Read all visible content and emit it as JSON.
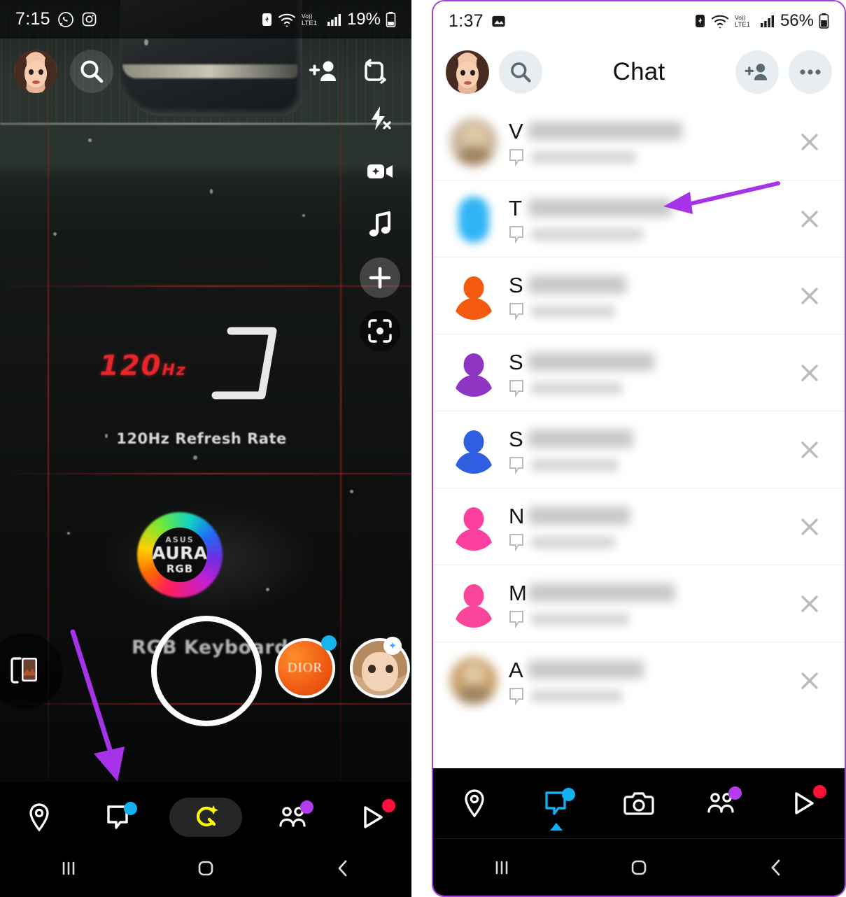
{
  "left_phone": {
    "status_bar": {
      "time": "7:15",
      "icons": [
        "whatsapp-icon",
        "instagram-icon"
      ],
      "right_icons": [
        "alarm-icon",
        "wifi-icon",
        "volte-lte1-icon",
        "signal-icon"
      ],
      "battery_percent": "19%"
    },
    "camera_top": {
      "avatar": "bitmoji-avatar",
      "search": "search-icon",
      "add_friend": "add-friend-icon",
      "flip_camera": "flip-camera-icon"
    },
    "camera_rail": [
      {
        "name": "flash-off-icon"
      },
      {
        "name": "night-video-icon"
      },
      {
        "name": "music-icon"
      },
      {
        "name": "add-lens-icon"
      },
      {
        "name": "scan-icon"
      }
    ],
    "scene": {
      "hz_main": "120",
      "hz_unit": "Hz",
      "caption": "120Hz Refresh Rate",
      "aura_brand": "ASUS",
      "aura_main": "AURA",
      "aura_sub": "RGB",
      "rgb_keyboard": "RGB Keyboard"
    },
    "capture_bar": {
      "memories": "memories-icon",
      "shutter": "shutter-button",
      "lens_1": "DIOR",
      "lens_2": "disney-lens"
    },
    "bottom_nav": [
      {
        "name": "map-tab",
        "icon": "location-pin-icon",
        "badge": "",
        "active": false
      },
      {
        "name": "chat-tab",
        "icon": "chat-bubble-icon",
        "badge": "blue",
        "active": false
      },
      {
        "name": "camera-tab",
        "icon": "sparkle-camera-icon",
        "badge": "",
        "active": true
      },
      {
        "name": "stories-tab",
        "icon": "friends-icon",
        "badge": "purple",
        "active": false
      },
      {
        "name": "spotlight-tab",
        "icon": "play-icon",
        "badge": "red",
        "active": false
      }
    ],
    "system_nav": [
      "recents-icon",
      "home-icon",
      "back-icon"
    ]
  },
  "right_phone": {
    "status_bar": {
      "time": "1:37",
      "icons": [
        "screenshot-icon"
      ],
      "right_icons": [
        "alarm-icon",
        "wifi-icon",
        "volte-lte1-icon",
        "signal-icon"
      ],
      "battery_percent": "56%"
    },
    "header": {
      "avatar": "bitmoji-avatar",
      "search": "search-icon",
      "title": "Chat",
      "add_friend": "add-friend-icon",
      "more": "more-options-icon"
    },
    "chat_rows": [
      {
        "initial": "V",
        "avatar_type": "photo",
        "avatar_color": "#c9b79c",
        "name_width": 220,
        "sub_width": 150,
        "close": "close-icon"
      },
      {
        "initial": "T",
        "avatar_type": "color",
        "avatar_color": "#2fb4f5",
        "name_width": 205,
        "sub_width": 160,
        "close": "close-icon"
      },
      {
        "initial": "S",
        "avatar_type": "color",
        "avatar_color": "#f35a10",
        "name_width": 140,
        "sub_width": 120,
        "close": "close-icon"
      },
      {
        "initial": "S",
        "avatar_type": "color",
        "avatar_color": "#8e35c4",
        "name_width": 180,
        "sub_width": 130,
        "close": "close-icon"
      },
      {
        "initial": "S",
        "avatar_type": "color",
        "avatar_color": "#2f5fe0",
        "name_width": 150,
        "sub_width": 125,
        "close": "close-icon"
      },
      {
        "initial": "N",
        "avatar_type": "color",
        "avatar_color": "#fb3f9e",
        "name_width": 145,
        "sub_width": 120,
        "close": "close-icon"
      },
      {
        "initial": "M",
        "avatar_type": "color",
        "avatar_color": "#f9459c",
        "name_width": 210,
        "sub_width": 140,
        "close": "close-icon"
      },
      {
        "initial": "A",
        "avatar_type": "photo",
        "avatar_color": "#caa06a",
        "name_width": 165,
        "sub_width": 130,
        "close": "close-icon"
      }
    ],
    "compose_button": "new-chat-icon",
    "bottom_nav": [
      {
        "name": "map-tab",
        "icon": "location-pin-icon",
        "badge": "",
        "active": false
      },
      {
        "name": "chat-tab",
        "icon": "chat-bubble-icon",
        "badge": "blue",
        "active": true
      },
      {
        "name": "camera-tab",
        "icon": "camera-icon",
        "badge": "",
        "active": false
      },
      {
        "name": "stories-tab",
        "icon": "friends-icon",
        "badge": "purple",
        "active": false
      },
      {
        "name": "spotlight-tab",
        "icon": "play-icon",
        "badge": "red",
        "active": false
      }
    ],
    "system_nav": [
      "recents-icon",
      "home-icon",
      "back-icon"
    ]
  },
  "annotations": {
    "arrow_color": "#a733e8",
    "arrow_left": "points-to-chat-tab",
    "arrow_right": "points-to-chat-row-2"
  },
  "colors": {
    "accent_blue": "#13b0f0",
    "accent_yellow": "#fffc00",
    "badge_purple": "#b33bf0",
    "badge_red": "#ff0f3a",
    "arrow_purple": "#a733e8"
  }
}
